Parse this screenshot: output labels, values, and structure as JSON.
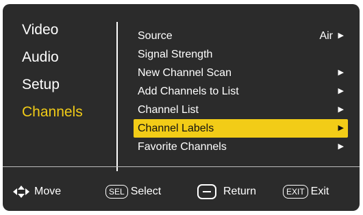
{
  "sidebar": {
    "items": [
      {
        "label": "Video"
      },
      {
        "label": "Audio"
      },
      {
        "label": "Setup"
      },
      {
        "label": "Channels"
      }
    ],
    "active_index": 3,
    "active_color": "#f2cc17"
  },
  "submenu": {
    "items": [
      {
        "label": "Source",
        "value": "Air",
        "arrow": "▶"
      },
      {
        "label": "Signal Strength",
        "value": "",
        "arrow": ""
      },
      {
        "label": "New Channel Scan",
        "value": "",
        "arrow": "▶"
      },
      {
        "label": "Add Channels to List",
        "value": "",
        "arrow": "▶"
      },
      {
        "label": "Channel List",
        "value": "",
        "arrow": "▶"
      },
      {
        "label": "Channel Labels",
        "value": "",
        "arrow": "▶"
      },
      {
        "label": "Favorite Channels",
        "value": "",
        "arrow": "▶"
      }
    ],
    "selected_index": 5,
    "highlight_color": "#f2cc17"
  },
  "footer": {
    "move": {
      "icon": "dpad-icon",
      "label": "Move"
    },
    "select": {
      "key": "SEL",
      "label": "Select"
    },
    "return": {
      "icon": "minus-button-icon",
      "label": "Return"
    },
    "exit": {
      "key": "EXIT",
      "label": "Exit"
    }
  },
  "colors": {
    "background": "#2b2b2b",
    "text": "#ffffff",
    "accent": "#f2cc17"
  }
}
